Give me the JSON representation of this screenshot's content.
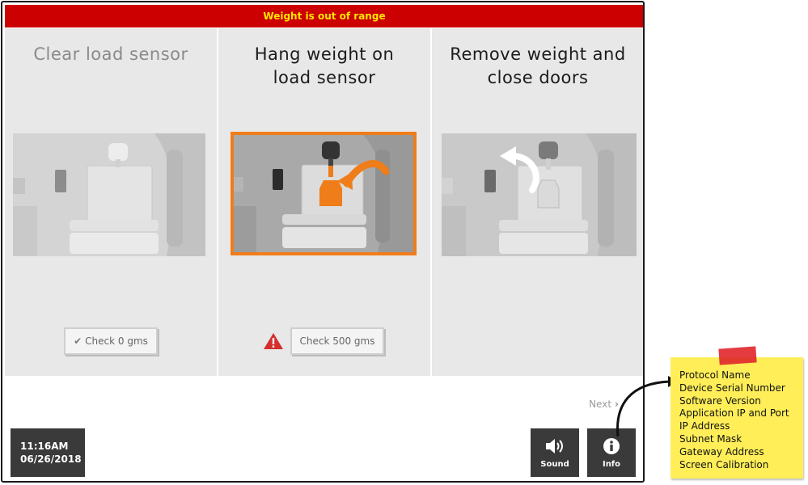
{
  "banner": {
    "text": "Weight is out of range",
    "bg_color": "#cc0000",
    "text_color": "#ffe600"
  },
  "steps": [
    {
      "title_line1": "Clear load sensor",
      "title_line2": "",
      "state": "done",
      "check_label": "Check 0 gms",
      "check_icon": "checkmark-icon"
    },
    {
      "title_line1": "Hang weight on",
      "title_line2": "load sensor",
      "state": "active",
      "check_label": "Check 500 gms",
      "warning_icon": "warning-triangle-icon"
    },
    {
      "title_line1": "Remove weight and",
      "title_line2": "close doors",
      "state": "pending"
    }
  ],
  "next_label": "Next",
  "clock": {
    "time": "11:16AM",
    "date": "06/26/2018"
  },
  "toolbar": {
    "sound": {
      "label": "Sound",
      "icon": "speaker-icon"
    },
    "info": {
      "label": "Info",
      "icon": "info-icon"
    }
  },
  "sticky_note": {
    "items": [
      "Protocol Name",
      "Device Serial Number",
      "Software Version",
      "Application IP and Port",
      "IP Address",
      "Subnet Mask",
      "Gateway Address",
      "Screen Calibration"
    ]
  },
  "colors": {
    "accent": "#f07d1a",
    "warning": "#d32f2f",
    "note": "#ffee58"
  }
}
